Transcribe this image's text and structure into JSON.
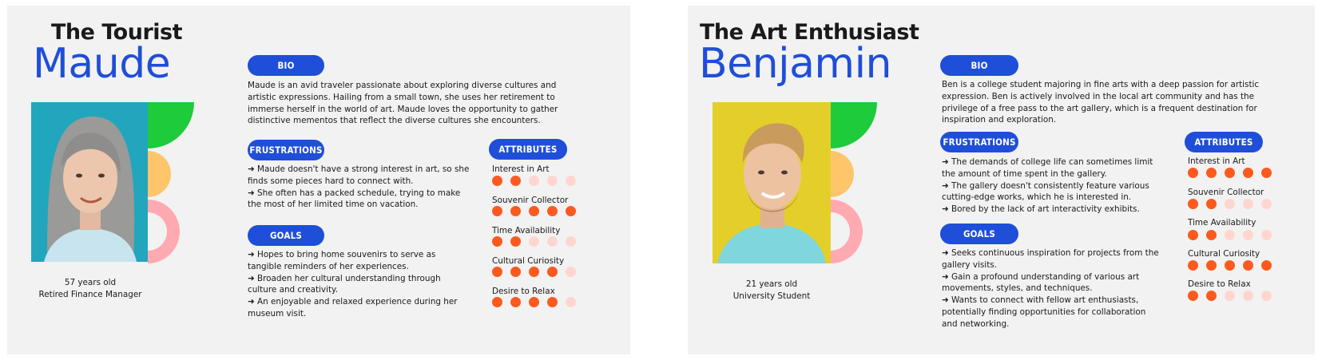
{
  "colors": {
    "accent": "#1f4ed8",
    "dot_on": "#fb5a1f",
    "dot_off": "#ffd6cf"
  },
  "section_labels": {
    "bio": "BIO",
    "frustrations": "FRUSTRATIONS",
    "goals": "GOALS",
    "attributes": "ATTRIBUTES"
  },
  "personas": [
    {
      "category": "The Tourist",
      "name": "Maude",
      "age": "57 years old",
      "occupation": "Retired Finance Manager",
      "bio_lines": [
        "Maude is an avid traveler passionate about exploring diverse cultures and",
        "artistic expressions. Hailing from a small town, she uses her retirement to",
        "immerse herself in the world of art. Maude loves the opportunity to gather",
        "distinctive mementos that reflect the diverse cultures she encounters."
      ],
      "frustration_lines": [
        "➜ Maude doesn't have a strong interest in art, so she",
        "finds some pieces hard to connect with.",
        "➜ She often has a packed schedule, trying to make",
        "the most of her limited time on vacation."
      ],
      "goal_lines": [
        "➜ Hopes to bring home souvenirs to serve as",
        "tangible reminders of her experiences.",
        "➜ Broaden her cultural understanding through",
        "culture and creativity.",
        "➜ An enjoyable and relaxed experience during her",
        "museum visit."
      ],
      "attributes": [
        {
          "label": "Interest in Art",
          "rating": 2
        },
        {
          "label": "Souvenir Collector",
          "rating": 5
        },
        {
          "label": "Time Availability",
          "rating": 2
        },
        {
          "label": "Cultural Curiosity",
          "rating": 4
        },
        {
          "label": "Desire to Relax",
          "rating": 4
        }
      ]
    },
    {
      "category": "The Art Enthusiast",
      "name": "Benjamin",
      "age": "21 years old",
      "occupation": "University Student",
      "bio_lines": [
        "Ben is a  college student majoring in fine arts with a deep passion for artistic",
        "expression. Ben is actively involved in the local art community and has the",
        "privilege of a free pass to the art gallery, which is a frequent destination for",
        "inspiration and exploration."
      ],
      "frustration_lines": [
        "➜ The demands of college life can sometimes limit",
        "the amount of time spent in the gallery.",
        "➜ The gallery doesn't consistently feature various",
        "cutting-edge works, which he is interested in.",
        "➜ Bored by the lack of art interactivity exhibits."
      ],
      "goal_lines": [
        "➜ Seeks continuous inspiration for projects from the",
        "gallery visits.",
        "➜ Gain a profound understanding of various art",
        "movements, styles, and techniques.",
        "➜ Wants to connect with fellow art enthusiasts,",
        "potentially finding opportunities for collaboration",
        "and networking."
      ],
      "attributes": [
        {
          "label": "Interest in Art",
          "rating": 5
        },
        {
          "label": "Souvenir Collector",
          "rating": 2
        },
        {
          "label": "Time Availability",
          "rating": 2
        },
        {
          "label": "Cultural Curiosity",
          "rating": 5
        },
        {
          "label": "Desire to Relax",
          "rating": 2
        }
      ]
    }
  ]
}
